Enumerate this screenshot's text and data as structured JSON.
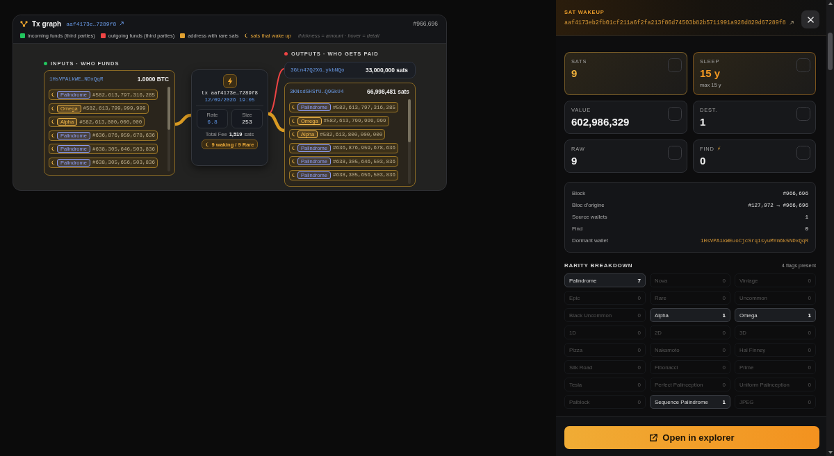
{
  "graph": {
    "title": "Tx graph",
    "tx_short": "aaf4173e…7289f8",
    "block": "#966,696",
    "legend": [
      {
        "kind": "swatch",
        "color": "#22c55e",
        "label": "incoming funds (third parties)"
      },
      {
        "kind": "swatch",
        "color": "#ef4444",
        "label": "outgoing funds (third parties)"
      },
      {
        "kind": "swatch",
        "color": "#e0a030",
        "label": "address with rare sats"
      },
      {
        "kind": "wake",
        "label": "sats that wake up"
      }
    ],
    "hint": "thickness = amount · hover = detail",
    "inputs": {
      "heading": "INPUTS · WHO FUNDS",
      "color": "#22c55e",
      "addresses": [
        {
          "address": "1HsVPAikWE…NDxQqR",
          "amount": "1.0000 BTC",
          "rare": true,
          "sats": [
            {
              "name": "Palindrome",
              "color": "#8b9cf4",
              "number": "#582,613,797,316,285"
            },
            {
              "name": "Omega",
              "color": "#efb54a",
              "number": "#582,613,799,999,999"
            },
            {
              "name": "Alpha",
              "color": "#efb54a",
              "number": "#582,613,800,000,000"
            },
            {
              "name": "Palindrome",
              "color": "#8b9cf4",
              "number": "#636,876,959,678,636"
            },
            {
              "name": "Palindrome",
              "color": "#8b9cf4",
              "number": "#638,305,646,503,836"
            },
            {
              "name": "Palindrome",
              "color": "#8b9cf4",
              "number": "#638,305,656,503,836"
            }
          ]
        }
      ]
    },
    "tx": {
      "label": "tx aaf4173e…7289f8",
      "date": "12/09/2026 19:05",
      "stats": [
        {
          "label": "Rate",
          "value": "6.8",
          "accent": true
        },
        {
          "label": "Size",
          "value": "253",
          "accent": false
        }
      ],
      "fee_label": "Total Fee",
      "fee": "1,519",
      "fee_unit": "sats",
      "badge": "9 waking / 9 Rare"
    },
    "outputs": {
      "heading": "OUTPUTS · WHO GETS PAID",
      "color": "#ef4444",
      "addresses": [
        {
          "address": "3Gtn47Q2XG…ykbNQo",
          "amount": "33,000,000 sats",
          "rare": false
        },
        {
          "address": "3KNsdSHSfU…Q9GkU4",
          "amount": "66,998,481 sats",
          "rare": true,
          "sats": [
            {
              "name": "Palindrome",
              "color": "#8b9cf4",
              "number": "#582,613,797,316,285"
            },
            {
              "name": "Omega",
              "color": "#efb54a",
              "number": "#582,613,799,999,999"
            },
            {
              "name": "Alpha",
              "color": "#efb54a",
              "number": "#582,613,800,000,000"
            },
            {
              "name": "Palindrome",
              "color": "#8b9cf4",
              "number": "#636,876,959,678,636"
            },
            {
              "name": "Palindrome",
              "color": "#8b9cf4",
              "number": "#638,305,646,503,836"
            },
            {
              "name": "Palindrome",
              "color": "#8b9cf4",
              "number": "#638,305,656,503,836"
            }
          ]
        }
      ]
    }
  },
  "panel": {
    "kicker": "SAT WAKEUP",
    "txid": "aaf4173eb2fb01cf211a6f2fa213f86d74503b82b5711991a920d829d67289f8",
    "stats": [
      {
        "label": "SATS",
        "value": "9",
        "color": "#f2b33d",
        "highlighted": true
      },
      {
        "label": "SLEEP",
        "value": "15 y",
        "sub": "max 15 y",
        "color": "#f59a23",
        "highlighted": true
      },
      {
        "label": "VALUE",
        "value": "602,986,329",
        "color": "#f2f2f2",
        "highlighted": false
      },
      {
        "label": "DEST.",
        "value": "1",
        "color": "#f2f2f2",
        "highlighted": false
      },
      {
        "label": "RAW",
        "value": "9",
        "color": "#f2f2f2",
        "highlighted": false
      },
      {
        "label": "FIND",
        "label_icon": "⚡",
        "value": "0",
        "color": "#f2f2f2",
        "highlighted": false
      }
    ],
    "details": [
      {
        "label": "Block",
        "value": "#966,696",
        "kind": "text"
      },
      {
        "label": "Bloc d'origine",
        "value": "#127,972 → #966,696",
        "kind": "text"
      },
      {
        "label": "Source wallets",
        "value": "1",
        "kind": "text"
      },
      {
        "label": "Find",
        "value": "0",
        "kind": "text"
      },
      {
        "label": "Dormant wallet",
        "value": "1HsVPAikWEuoCjcSrq1syuMYm6k5NDxQqR",
        "kind": "address"
      }
    ],
    "rarity": {
      "title": "RARITY BREAKDOWN",
      "summary": "4 flags present",
      "items": [
        {
          "name": "Palindrome",
          "count": "7",
          "present": true
        },
        {
          "name": "Nova",
          "count": "0",
          "present": false
        },
        {
          "name": "Vintage",
          "count": "0",
          "present": false
        },
        {
          "name": "Epic",
          "count": "0",
          "present": false
        },
        {
          "name": "Rare",
          "count": "0",
          "present": false
        },
        {
          "name": "Uncommon",
          "count": "0",
          "present": false
        },
        {
          "name": "Black Uncommon",
          "count": "0",
          "present": false
        },
        {
          "name": "Alpha",
          "count": "1",
          "present": true
        },
        {
          "name": "Omega",
          "count": "1",
          "present": true
        },
        {
          "name": "1D",
          "count": "0",
          "present": false
        },
        {
          "name": "2D",
          "count": "0",
          "present": false
        },
        {
          "name": "3D",
          "count": "0",
          "present": false
        },
        {
          "name": "Pizza",
          "count": "0",
          "present": false
        },
        {
          "name": "Nakamoto",
          "count": "0",
          "present": false
        },
        {
          "name": "Hal Finney",
          "count": "0",
          "present": false
        },
        {
          "name": "Silk Road",
          "count": "0",
          "present": false
        },
        {
          "name": "Fibonacci",
          "count": "0",
          "present": false
        },
        {
          "name": "Prime",
          "count": "0",
          "present": false
        },
        {
          "name": "Tesla",
          "count": "0",
          "present": false
        },
        {
          "name": "Perfect Palinception",
          "count": "0",
          "present": false
        },
        {
          "name": "Uniform Palinception",
          "count": "0",
          "present": false
        },
        {
          "name": "Palblock",
          "count": "0",
          "present": false
        },
        {
          "name": "Sequence Palindrome",
          "count": "1",
          "present": true
        },
        {
          "name": "JPEG",
          "count": "0",
          "present": false
        }
      ]
    },
    "button": "Open in explorer"
  }
}
